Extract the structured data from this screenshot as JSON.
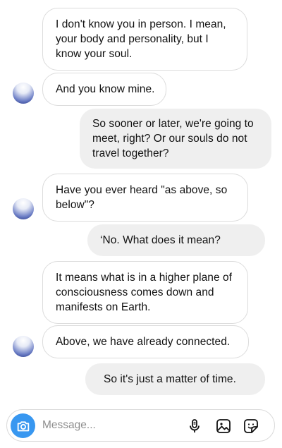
{
  "messages": [
    {
      "side": "in",
      "text": "I don't know you in person. I mean, your body and personality, but I know your soul."
    },
    {
      "side": "in",
      "text": "And you know mine."
    },
    {
      "side": "out",
      "text": "So sooner or later, we're going to meet, right? Or our souls do not travel together?"
    },
    {
      "side": "in",
      "text": "Have you ever heard \"as above, so below\"?"
    },
    {
      "side": "out",
      "text": "‘No. What does it mean?"
    },
    {
      "side": "in",
      "text": "It means what is in a higher plane of consciousness comes down and manifests on Earth."
    },
    {
      "side": "in",
      "text": "Above, we have already connected."
    },
    {
      "side": "out",
      "text": "So it's just a matter of time."
    }
  ],
  "composer": {
    "placeholder": "Message...",
    "icons": [
      "camera-icon",
      "microphone-icon",
      "gallery-icon",
      "sticker-icon"
    ]
  },
  "colors": {
    "camera_button": "#3897f0",
    "outgoing_bubble": "#efefef",
    "incoming_border": "#dcdcdc",
    "placeholder": "#8e8e8e"
  }
}
